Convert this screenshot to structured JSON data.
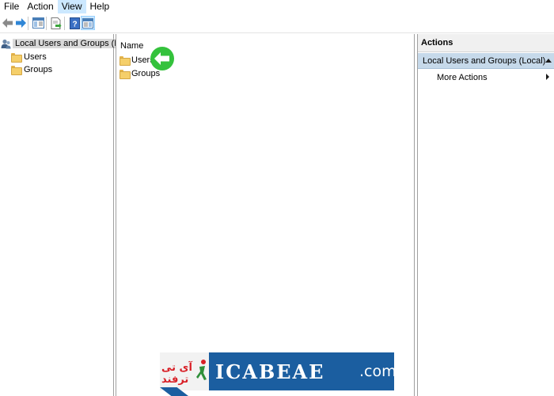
{
  "menu": {
    "items": [
      {
        "label": "File",
        "active": false
      },
      {
        "label": "Action",
        "active": false
      },
      {
        "label": "View",
        "active": true
      },
      {
        "label": "Help",
        "active": false
      }
    ]
  },
  "toolbar": {
    "icons": [
      "back-arrow-icon",
      "forward-arrow-icon",
      "show-hide-tree-icon",
      "export-list-icon",
      "help-icon",
      "show-hide-action-pane-icon"
    ]
  },
  "tree": {
    "root_label": "Local Users and Groups (Local)",
    "children": [
      {
        "label": "Users"
      },
      {
        "label": "Groups"
      }
    ]
  },
  "center": {
    "column_header": "Name",
    "items": [
      {
        "label": "Users"
      },
      {
        "label": "Groups"
      }
    ]
  },
  "actions": {
    "header": "Actions",
    "group_label": "Local Users and Groups (Local)",
    "items": [
      {
        "label": "More Actions"
      }
    ]
  },
  "watermark": {
    "persian_text": "آی تی ترفند",
    "brand_text": "ICABEAE",
    "dotcom_text": ".com"
  },
  "colors": {
    "accent_green": "#34c23c",
    "actions_group_bg": "#c6d9ea",
    "watermark_blue": "#1b5ea0",
    "watermark_red": "#d81f26"
  }
}
